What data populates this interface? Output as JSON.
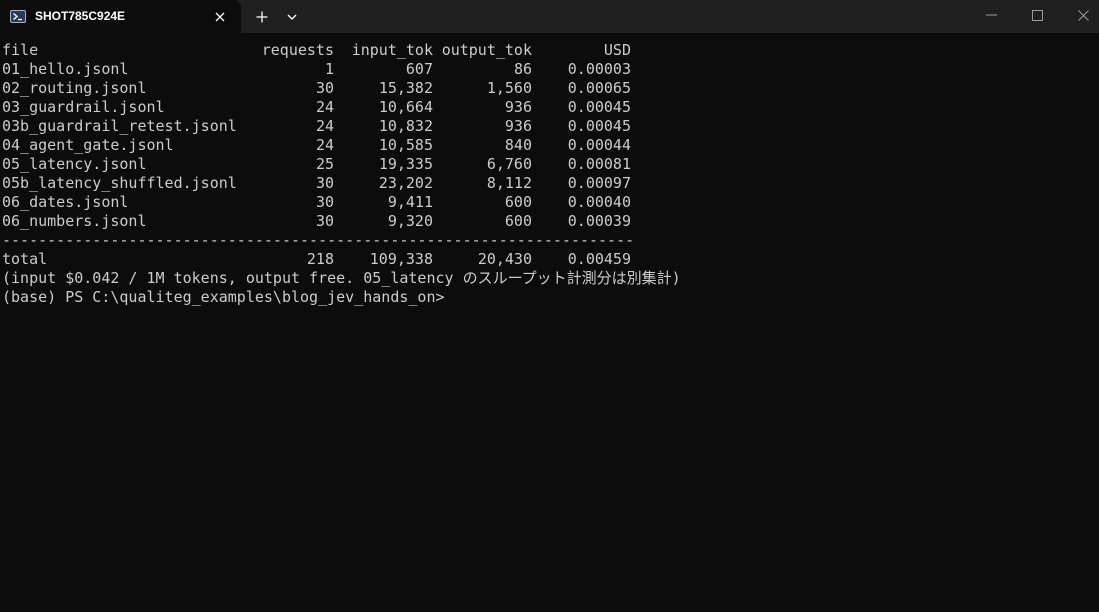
{
  "window": {
    "tab_title": "SHOT785C924E",
    "new_tab_icon": "plus-icon",
    "dropdown_icon": "chevron-down-icon"
  },
  "table": {
    "headers": {
      "file": "file",
      "requests": "requests",
      "input_tok": "input_tok",
      "output_tok": "output_tok",
      "usd": "USD"
    },
    "rows": [
      {
        "file": "01_hello.jsonl",
        "requests": "1",
        "input_tok": "607",
        "output_tok": "86",
        "usd": "0.00003"
      },
      {
        "file": "02_routing.jsonl",
        "requests": "30",
        "input_tok": "15,382",
        "output_tok": "1,560",
        "usd": "0.00065"
      },
      {
        "file": "03_guardrail.jsonl",
        "requests": "24",
        "input_tok": "10,664",
        "output_tok": "936",
        "usd": "0.00045"
      },
      {
        "file": "03b_guardrail_retest.jsonl",
        "requests": "24",
        "input_tok": "10,832",
        "output_tok": "936",
        "usd": "0.00045"
      },
      {
        "file": "04_agent_gate.jsonl",
        "requests": "24",
        "input_tok": "10,585",
        "output_tok": "840",
        "usd": "0.00044"
      },
      {
        "file": "05_latency.jsonl",
        "requests": "25",
        "input_tok": "19,335",
        "output_tok": "6,760",
        "usd": "0.00081"
      },
      {
        "file": "05b_latency_shuffled.jsonl",
        "requests": "30",
        "input_tok": "23,202",
        "output_tok": "8,112",
        "usd": "0.00097"
      },
      {
        "file": "06_dates.jsonl",
        "requests": "30",
        "input_tok": "9,411",
        "output_tok": "600",
        "usd": "0.00040"
      },
      {
        "file": "06_numbers.jsonl",
        "requests": "30",
        "input_tok": "9,320",
        "output_tok": "600",
        "usd": "0.00039"
      }
    ],
    "separator": "----------------------------------------------------------------------",
    "total": {
      "file": "total",
      "requests": "218",
      "input_tok": "109,338",
      "output_tok": "20,430",
      "usd": "0.00459"
    }
  },
  "note": "(input $0.042 / 1M tokens, output free. 05_latency のスループット計測分は別集計)",
  "prompt": "(base) PS C:\\qualiteg_examples\\blog_jev_hands_on>"
}
